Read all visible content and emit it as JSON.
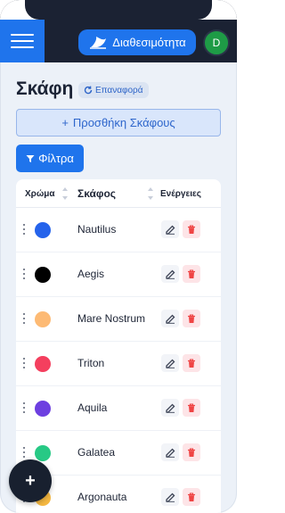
{
  "header": {
    "menu_icon": "hamburger-icon",
    "availability_label": "Διαθεσιμότητα",
    "availability_icon": "sail-icon",
    "avatar_initial": "D"
  },
  "page": {
    "title": "Σκάφη",
    "reset_label": "Επαναφορά",
    "add_boat_label": "Προσθήκη Σκάφους",
    "filter_label": "Φίλτρα"
  },
  "table": {
    "headers": {
      "color": "Χρώμα",
      "boat": "Σκάφος",
      "actions": "Ενέργειες"
    },
    "rows": [
      {
        "name": "Nautilus",
        "color": "#2563eb"
      },
      {
        "name": "Aegis",
        "color": "#000000"
      },
      {
        "name": "Mare Nostrum",
        "color": "#fdba74"
      },
      {
        "name": "Triton",
        "color": "#f43f5e"
      },
      {
        "name": "Aquila",
        "color": "#6d3fe0"
      },
      {
        "name": "Galatea",
        "color": "#27c985"
      },
      {
        "name": "Argonauta",
        "color": "#f5b841"
      }
    ]
  },
  "fab": {
    "label": "+"
  },
  "colors": {
    "primary": "#1f74ec",
    "dark": "#1b2233",
    "danger": "#ef4444"
  }
}
